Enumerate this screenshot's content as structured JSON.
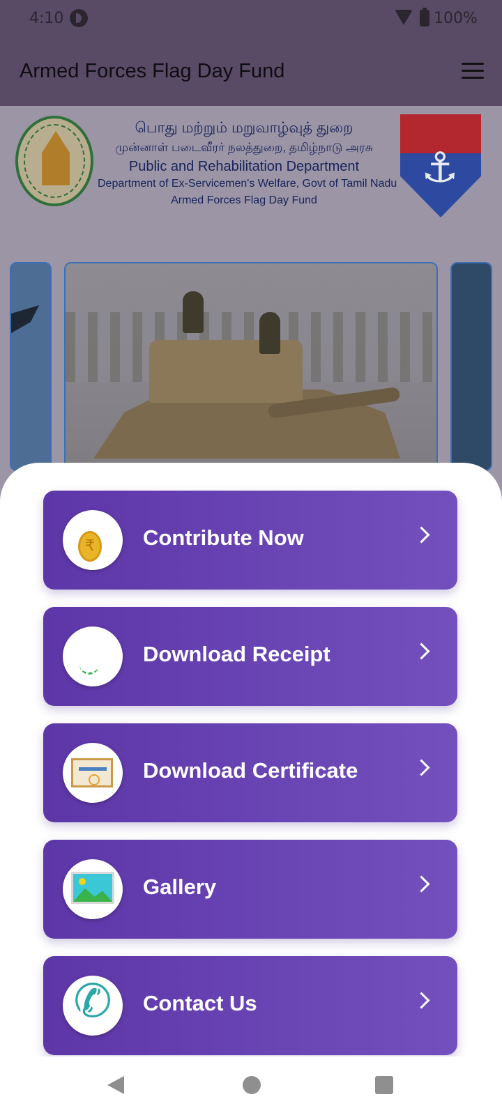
{
  "status_bar": {
    "time": "4:10",
    "battery": "100%"
  },
  "app_bar": {
    "title": "Armed Forces Flag Day Fund"
  },
  "banner": {
    "line_tamil_1": "பொது மற்றும் மறுவாழ்வுத் துறை",
    "line_tamil_2": "முன்னாள் படைவீரர் நலத்துறை, தமிழ்நாடு அரசு",
    "line_en_1": "Public and Rehabilitation Department",
    "line_en_2": "Department of  Ex-Servicemen's  Welfare, Govt of  Tamil Nadu",
    "line_en_3": "Armed Forces Flag Day Fund"
  },
  "menu": [
    {
      "label": "Contribute Now",
      "icon": "rupee-coin-icon"
    },
    {
      "label": "Download Receipt",
      "icon": "receipt-icon"
    },
    {
      "label": "Download Certificate",
      "icon": "certificate-icon"
    },
    {
      "label": "Gallery",
      "icon": "gallery-icon"
    },
    {
      "label": "Contact Us",
      "icon": "phone-icon"
    }
  ],
  "theme": {
    "accent_start": "#5d36a8",
    "accent_end": "#7350bd",
    "app_bar": "#594a66"
  }
}
